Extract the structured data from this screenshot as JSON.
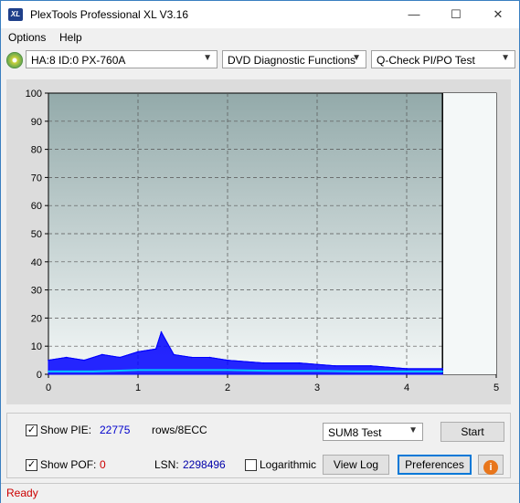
{
  "window": {
    "title": "PlexTools Professional XL V3.16",
    "icon_label": "XL",
    "minimize_label": "—",
    "maximize_label": "☐",
    "close_label": "✕"
  },
  "menu": [
    "Options",
    "Help"
  ],
  "toolbar": {
    "drive": "HA:8 ID:0  PX-760A",
    "function": "DVD Diagnostic Functions",
    "test": "Q-Check PI/PO Test"
  },
  "chart_data": {
    "type": "line",
    "ylim": [
      0,
      100
    ],
    "xlim": [
      0,
      5
    ],
    "yticks": [
      "0",
      "10",
      "20",
      "30",
      "40",
      "50",
      "60",
      "70",
      "80",
      "90",
      "100"
    ],
    "xticks": [
      "0",
      "1",
      "2",
      "3",
      "4",
      "5"
    ],
    "grid": true,
    "end_marker_x": 4.4,
    "series": [
      {
        "color": "#0000ff",
        "x": [
          0.0,
          0.2,
          0.4,
          0.6,
          0.8,
          1.0,
          1.2,
          1.26,
          1.4,
          1.6,
          1.8,
          2.0,
          2.4,
          2.8,
          3.2,
          3.6,
          4.0,
          4.4
        ],
        "values": [
          5,
          6,
          5,
          7,
          6,
          8,
          9,
          15,
          7,
          6,
          6,
          5,
          4,
          4,
          3,
          3,
          2,
          2
        ]
      },
      {
        "color": "#00c8ff",
        "x": [
          0.0,
          0.5,
          1.0,
          1.5,
          2.0,
          2.5,
          3.0,
          3.5,
          4.0,
          4.4
        ],
        "values": [
          1,
          1,
          1.5,
          1.5,
          1.5,
          1.2,
          1.2,
          1,
          1,
          1
        ]
      }
    ]
  },
  "controls": {
    "show_pie_label": "Show PIE:",
    "pie_value": "22775",
    "rows_label": "rows/8ECC",
    "show_pof_label": "Show POF:",
    "pof_value": "0",
    "lsn_label": "LSN:",
    "lsn_value": "2298496",
    "logarithmic_label": "Logarithmic",
    "test_mode": "SUM8 Test",
    "start_label": "Start",
    "view_log_label": "View Log",
    "preferences_label": "Preferences",
    "info_icon_label": "i",
    "checkmark": "✓"
  },
  "status": "Ready",
  "colors": {
    "plot_top": "#93aaaa",
    "plot_bottom": "#f4f8f8",
    "pie_value": "#0000cc",
    "pof_value": "#cc0000",
    "status": "#cc0000",
    "info_button": "#e8761c"
  }
}
